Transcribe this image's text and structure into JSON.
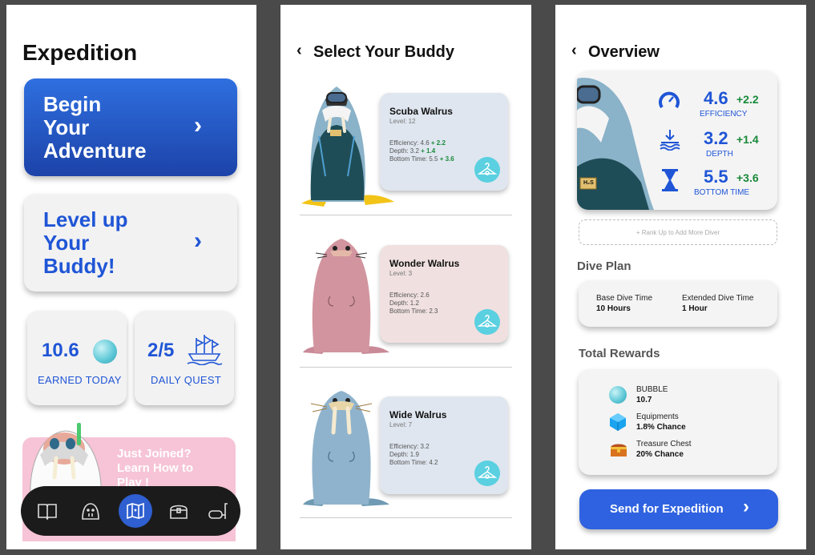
{
  "home": {
    "title": "Expedition",
    "begin": {
      "l1": "Begin",
      "l2": "Your",
      "l3": "Adventure"
    },
    "levelup": {
      "l1": "Level up",
      "l2": "Your",
      "l3": "Buddy!"
    },
    "earned": {
      "value": "10.6",
      "label": "EARNED TODAY"
    },
    "quest": {
      "value": "2/5",
      "label": "DAILY QUEST"
    },
    "promo": {
      "l1": "Just Joined?",
      "l2": "Learn How to",
      "l3": "Play !"
    },
    "nav": [
      "book-icon",
      "buddy-icon",
      "map-icon",
      "chest-icon",
      "snorkel-icon"
    ]
  },
  "select": {
    "title": "Select Your Buddy",
    "buddies": [
      {
        "name": "Scuba Walrus",
        "level": "Level: 12",
        "eff": "Efficiency: 4.6",
        "eff_bonus": "+ 2.2",
        "depth": "Depth: 3.2",
        "depth_bonus": "+ 1.4",
        "bottom": "Bottom Time: 5.5",
        "bottom_bonus": "+ 3.6"
      },
      {
        "name": "Wonder Walrus",
        "level": "Level: 3",
        "eff": "Efficiency: 2.6",
        "depth": "Depth: 1.2",
        "bottom": "Bottom Time: 2.3"
      },
      {
        "name": "Wide Walrus",
        "level": "Level: 7",
        "eff": "Efficiency: 3.2",
        "depth": "Depth: 1.9",
        "bottom": "Bottom Time: 4.2"
      }
    ]
  },
  "overview": {
    "title": "Overview",
    "stats": [
      {
        "value": "4.6",
        "bonus": "+2.2",
        "label": "EFFICIENCY"
      },
      {
        "value": "3.2",
        "bonus": "+1.4",
        "label": "DEPTH"
      },
      {
        "value": "5.5",
        "bonus": "+3.6",
        "label": "BOTTOM TIME"
      }
    ],
    "badge": "H₂S",
    "add_diver": "+   Rank Up to Add More Diver",
    "dive_plan": {
      "heading": "Dive Plan",
      "base_label": "Base Dive Time",
      "base_value": "10 Hours",
      "ext_label": "Extended Dive Time",
      "ext_value": "1 Hour"
    },
    "rewards": {
      "heading": "Total Rewards",
      "items": [
        {
          "name": "BUBBLE",
          "value": "10.7"
        },
        {
          "name": "Equipments",
          "value": "1.8% Chance"
        },
        {
          "name": "Treasure Chest",
          "value": "20% Chance"
        }
      ]
    },
    "send": "Send for Expedition"
  },
  "colors": {
    "accent": "#1f55d6",
    "bonus": "#1a8a3a",
    "bubble": "#5ad0e0"
  }
}
